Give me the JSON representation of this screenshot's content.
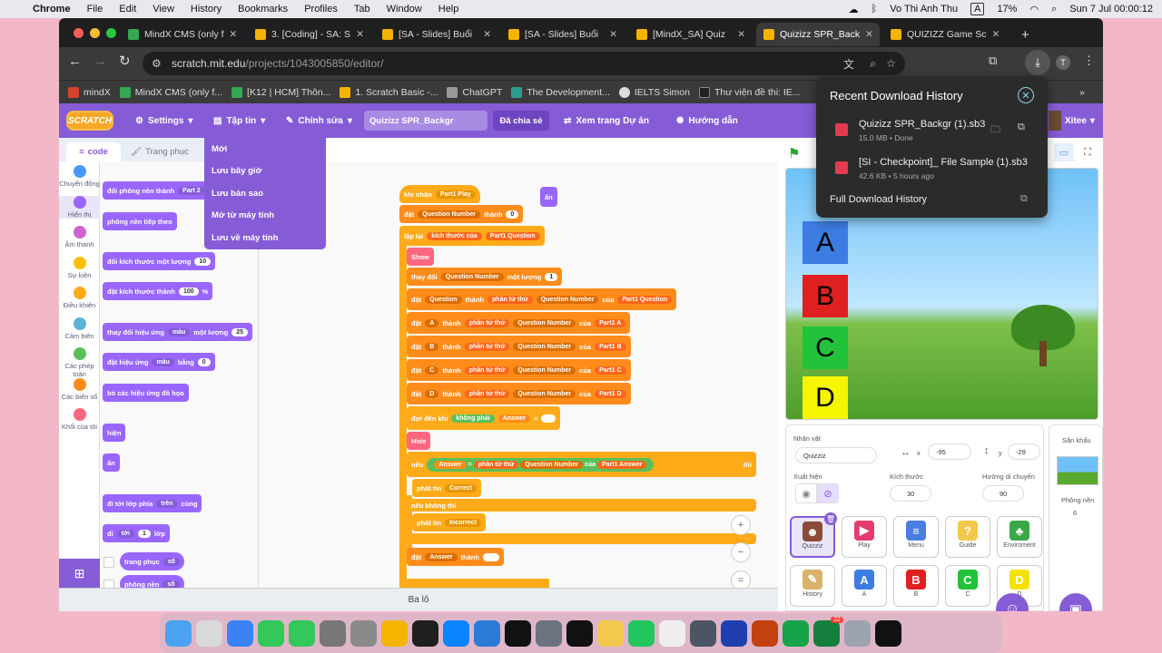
{
  "menubar": {
    "app": "Chrome",
    "items": [
      "File",
      "Edit",
      "View",
      "History",
      "Bookmarks",
      "Profiles",
      "Tab",
      "Window",
      "Help"
    ],
    "user": "Vo Thi Anh Thu",
    "battery": "17%",
    "clock": "Sun 7 Jul  00:00:12",
    "input": "A"
  },
  "tabs": [
    {
      "label": "MindX CMS (only f",
      "color": "#34a853"
    },
    {
      "label": "3. [Coding] - SA: S",
      "color": "#f4b400"
    },
    {
      "label": "[SA - Slides] Buổi",
      "color": "#f4b400"
    },
    {
      "label": "[SA - Slides] Buổi",
      "color": "#f4b400"
    },
    {
      "label": "[MindX_SA] Quiz",
      "color": "#f4b400"
    },
    {
      "label": "Quizizz SPR_Back",
      "color": "#f4b400"
    },
    {
      "label": "QUIZIZZ Game Sc",
      "color": "#f4b400"
    }
  ],
  "url": {
    "host": "scratch.mit.edu",
    "path": "/projects/1043005850/editor/"
  },
  "bookmarks": [
    "mindX",
    "MindX CMS (only f...",
    "[K12 | HCM] Thôn...",
    "1. Scratch Basic -...",
    "ChatGPT",
    "The Development...",
    "IELTS Simon",
    "Thư viện đề thi: IE..."
  ],
  "scratch_menu": {
    "logo": "SCRATCH",
    "settings": "Settings",
    "file": "Tập tin",
    "edit": "Chỉnh sửa",
    "project_title": "Quizizz SPR_Backgr",
    "shared": "Đã chia sẻ",
    "see_project": "Xem trang Dự án",
    "tutorials": "Hướng dẫn",
    "user": "Xitee"
  },
  "file_menu": [
    "Mới",
    "Lưu bây giờ",
    "Lưu bản sao",
    "Mở từ máy tính",
    "Lưu về máy tính"
  ],
  "editor_tabs": {
    "code": "code",
    "costumes": "Trang phục"
  },
  "categories": [
    {
      "label": "Chuyển động",
      "color": "#4c97ff"
    },
    {
      "label": "Hiển thị",
      "color": "#9966ff"
    },
    {
      "label": "Âm thanh",
      "color": "#cf63cf"
    },
    {
      "label": "Sự kiện",
      "color": "#ffbf00"
    },
    {
      "label": "Điều khiển",
      "color": "#ffab19"
    },
    {
      "label": "Cảm biến",
      "color": "#5cb1d6"
    },
    {
      "label": "Các phép toán",
      "color": "#59c059"
    },
    {
      "label": "Các biến số",
      "color": "#ff8c1a"
    },
    {
      "label": "Khối của tôi",
      "color": "#ff6680"
    }
  ],
  "palette": {
    "b1": "đổi phông nền thành",
    "b1v": "Part 2",
    "b2": "phông nền tiếp theo",
    "b3": "đổi kích thước một lượng",
    "b3v": "10",
    "b4": "đặt kích thước thành",
    "b4v": "100",
    "b4u": "%",
    "b5": "thay đổi hiệu ứng",
    "b5d": "màu",
    "b5m": "một lượng",
    "b5v": "25",
    "b6": "đặt hiệu ứng",
    "b6d": "màu",
    "b6m": "bằng",
    "b6v": "0",
    "b7": "bỏ các hiệu ứng đồ họa",
    "b8": "hiện",
    "b9": "ẩn",
    "b10": "đi tới lớp phía",
    "b10d": "trên",
    "b10m": "cùng",
    "b11": "đi",
    "b11d": "tới",
    "b11v": "1",
    "b11m": "lớp",
    "r1": "trang phục",
    "r1d": "số",
    "r2": "phông nền",
    "r2d": "số"
  },
  "script": {
    "hat": "khi nhận",
    "hat_v": "Part1 Play",
    "set1": "đặt",
    "set1_var": "Question Number",
    "set1_to": "thành",
    "set1_v": "0",
    "repeat": "lặp lại",
    "repeat_op": "kích thước của",
    "repeat_list": "Part1 Question",
    "show": "Show",
    "change": "thay đổi",
    "change_var": "Question Number",
    "change_by": "một lượng",
    "change_v": "1",
    "setq": "đặt",
    "setq_var": "Question",
    "to": "thành",
    "item": "phần tử thứ",
    "item_idx": "Question Number",
    "of": "của",
    "setq_list": "Part1 Question",
    "letters": [
      "A",
      "B",
      "C",
      "D"
    ],
    "lists": [
      "Part1 A",
      "Part1 B",
      "Part1 C",
      "Part1 D"
    ],
    "wait": "đợi đến khi",
    "not": "không phải",
    "answer": "Answer",
    "eq": "=",
    "hide": "Hide",
    "if": "nếu",
    "if_list": "Part1 Answer",
    "then": "thì",
    "broadcast": "phát tin",
    "correct": "Correct",
    "else": "nếu không thì",
    "incorrect": "Incorrect",
    "setans": "đặt",
    "setans_var": "Answer",
    "setans_to": "thành",
    "top1": "ẩn"
  },
  "backpack": "Ba lô",
  "stage_letters": [
    "A",
    "B",
    "C",
    "D"
  ],
  "sprite_info": {
    "label": "Nhân vật",
    "name": "Quizziz",
    "x_label": "x",
    "x": "-95",
    "y_label": "y",
    "y": "-29",
    "show": "Xuất hiện",
    "size_label": "Kích thước",
    "size": "30",
    "dir_label": "Hướng di chuyển",
    "dir": "90"
  },
  "stage_panel": {
    "label": "Sân khấu",
    "backdrops_label": "Phông nền",
    "backdrops": "6"
  },
  "sprites": [
    {
      "name": "Quizziz",
      "icon": "☻",
      "color": "#8a4b3a"
    },
    {
      "name": "Play",
      "icon": "▶",
      "color": "#e63b6f"
    },
    {
      "name": "Menu",
      "icon": "≡",
      "color": "#4a7ce2"
    },
    {
      "name": "Guide",
      "icon": "?",
      "color": "#f2c94c"
    },
    {
      "name": "Enviroment",
      "icon": "♣",
      "color": "#3aa845"
    },
    {
      "name": "History",
      "icon": "✎",
      "color": "#d9b36c"
    },
    {
      "name": "A",
      "icon": "A",
      "color": "#3d7ce2"
    },
    {
      "name": "B",
      "icon": "B",
      "color": "#e02020"
    },
    {
      "name": "C",
      "icon": "C",
      "color": "#22c33a"
    },
    {
      "name": "D",
      "icon": "D",
      "color": "#f5e100"
    }
  ],
  "download": {
    "title": "Recent Download History",
    "items": [
      {
        "name": "Quizizz SPR_Backgr (1).sb3",
        "meta": "15.0 MB • Done"
      },
      {
        "name": "[SI - Checkpoint]_ File Sample (1).sb3",
        "meta": "42.6 KB • 5 hours ago"
      }
    ],
    "full": "Full Download History"
  },
  "dock_badge": "22"
}
